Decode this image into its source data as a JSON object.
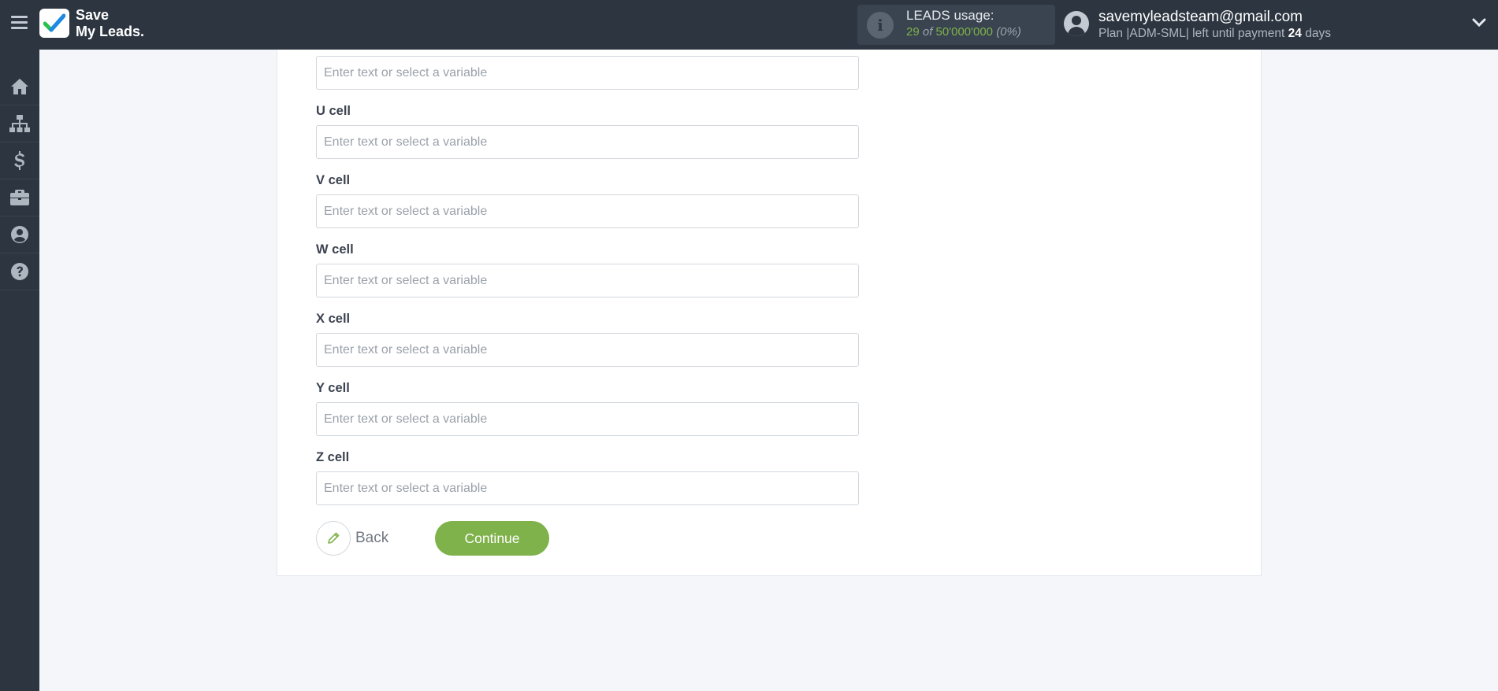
{
  "header": {
    "logo_line1": "Save",
    "logo_line2": "My Leads.",
    "usage": {
      "title": "LEADS usage:",
      "used": "29",
      "of": "of",
      "limit": "50'000'000",
      "percent": "(0%)"
    },
    "user": {
      "email": "savemyleadsteam@gmail.com",
      "plan_prefix": "Plan |ADM-SML| left until payment",
      "days_count": "24",
      "days_suffix": "days"
    }
  },
  "sidebar": {
    "items": [
      {
        "icon": "home-icon"
      },
      {
        "icon": "sitemap-icon"
      },
      {
        "icon": "dollar-icon"
      },
      {
        "icon": "briefcase-icon"
      },
      {
        "icon": "user-circle-icon"
      },
      {
        "icon": "question-circle-icon"
      }
    ]
  },
  "form": {
    "placeholder": "Enter text or select a variable",
    "fields": [
      {
        "label": "",
        "value": ""
      },
      {
        "label": "U cell",
        "value": ""
      },
      {
        "label": "V cell",
        "value": ""
      },
      {
        "label": "W cell",
        "value": ""
      },
      {
        "label": "X cell",
        "value": ""
      },
      {
        "label": "Y cell",
        "value": ""
      },
      {
        "label": "Z cell",
        "value": ""
      }
    ]
  },
  "actions": {
    "back_label": "Back",
    "continue_label": "Continue"
  },
  "colors": {
    "topbar": "#2c3540",
    "accent_green": "#7fb24a",
    "logo_check_green": "#27c24c",
    "logo_check_blue": "#1e88e5"
  }
}
